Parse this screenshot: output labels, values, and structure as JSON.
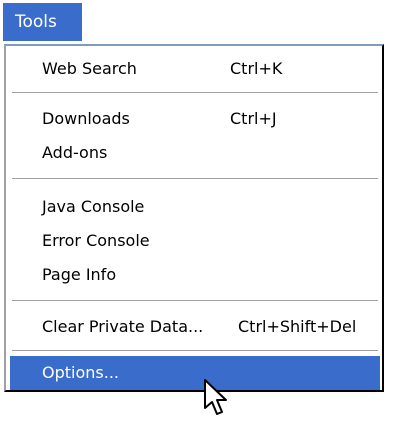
{
  "menubar": {
    "title": "Tools",
    "title_accel": "T"
  },
  "menu": {
    "items": [
      {
        "label": "Web Search",
        "shortcut": "Ctrl+K"
      },
      {
        "label": "Downloads",
        "shortcut": "Ctrl+J"
      },
      {
        "label": "Add-ons",
        "shortcut": ""
      },
      {
        "label": "Java Console",
        "shortcut": ""
      },
      {
        "label": "Error Console",
        "shortcut": ""
      },
      {
        "label": "Page Info",
        "shortcut": ""
      },
      {
        "label": "Clear Private Data...",
        "shortcut": "Ctrl+Shift+Del"
      },
      {
        "label": "Options...",
        "shortcut": ""
      }
    ]
  },
  "colors": {
    "highlight": "#3a6ccc",
    "highlight_text": "#ffffff",
    "text": "#000000",
    "separator": "#a0a0a0"
  },
  "cursor": {
    "icon": "arrow-cursor-icon"
  }
}
